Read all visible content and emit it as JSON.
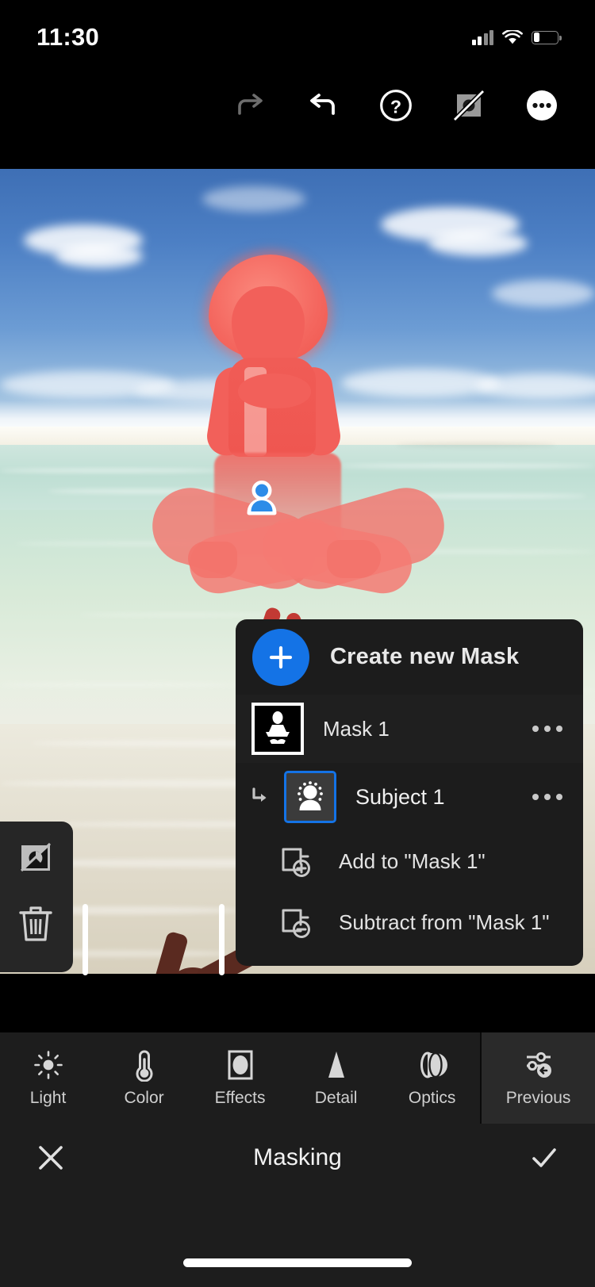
{
  "status_bar": {
    "time": "11:30",
    "cellular_icon": "signal-bars-icon",
    "wifi_icon": "wifi-icon",
    "battery_icon": "battery-icon",
    "battery_level_pct": 27
  },
  "top_toolbar": {
    "buttons": [
      {
        "name": "redo-button",
        "icon": "redo-arrow-icon",
        "enabled": false
      },
      {
        "name": "undo-button",
        "icon": "undo-arrow-icon",
        "enabled": true
      },
      {
        "name": "help-button",
        "icon": "question-mark-circle-icon",
        "enabled": true
      },
      {
        "name": "toggle-overlay-button",
        "icon": "image-slashed-icon",
        "enabled": true
      },
      {
        "name": "more-options-button",
        "icon": "ellipsis-circle-icon",
        "enabled": true
      }
    ]
  },
  "photo": {
    "alt": "Child sitting cross-legged in shallow clear tropical water with red subject-mask overlay",
    "mask_overlay_color": "#f4675f",
    "subject_pin_icon": "person-pin-icon",
    "subject_pin_color": "#1a7fe0"
  },
  "left_panel": {
    "buttons": [
      {
        "name": "invert-mask-button",
        "icon": "invert-mask-icon"
      },
      {
        "name": "delete-mask-button",
        "icon": "trash-icon"
      }
    ]
  },
  "mask_panel": {
    "create_new_mask": {
      "label": "Create new Mask",
      "icon": "plus-icon",
      "accent_color": "#1473e6"
    },
    "masks": [
      {
        "name": "Mask 1",
        "thumbnail_icon": "mask-thumbnail-subject-silhouette",
        "selected": true,
        "overflow_icon": "ellipsis-icon"
      }
    ],
    "sub_masks": [
      {
        "name": "Subject 1",
        "icon": "subject-select-person-icon",
        "selected": true,
        "selection_color": "#1473e6",
        "overflow_icon": "ellipsis-icon",
        "child_arrow_icon": "corner-down-right-arrow-icon"
      }
    ],
    "actions": [
      {
        "label": "Add to \"Mask 1\"",
        "icon": "add-to-mask-icon"
      },
      {
        "label": "Subtract from \"Mask 1\"",
        "icon": "subtract-from-mask-icon"
      }
    ]
  },
  "bottom_nav": {
    "items": [
      {
        "label": "Light",
        "icon": "sun-icon",
        "active": false
      },
      {
        "label": "Color",
        "icon": "thermometer-icon",
        "active": false
      },
      {
        "label": "Effects",
        "icon": "vignette-square-icon",
        "active": false
      },
      {
        "label": "Detail",
        "icon": "triangle-icon",
        "active": false
      },
      {
        "label": "Optics",
        "icon": "lens-icon",
        "active": false
      },
      {
        "label": "Previous",
        "icon": "sliders-back-arrow-icon",
        "active": true
      }
    ]
  },
  "masking_bar": {
    "title": "Masking",
    "cancel_icon": "close-x-icon",
    "confirm_icon": "checkmark-icon"
  },
  "home_indicator": {
    "name": "home-indicator"
  }
}
